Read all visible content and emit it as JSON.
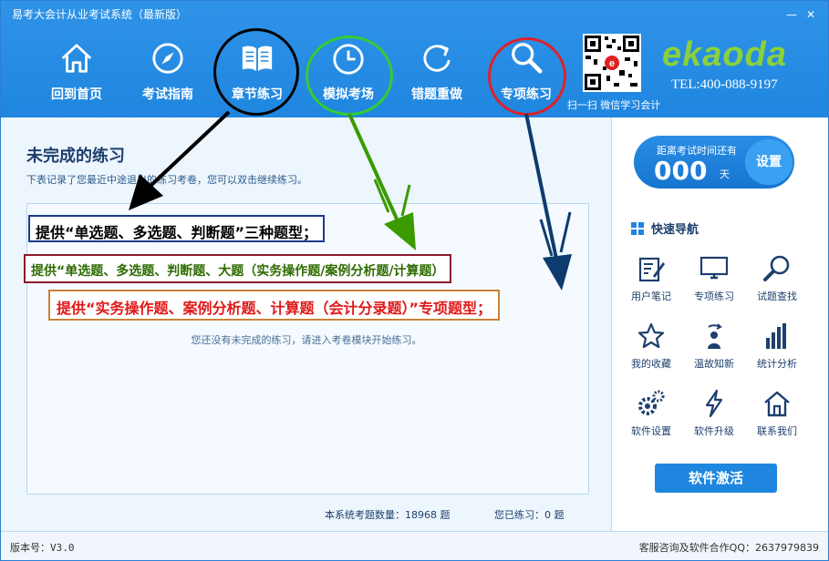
{
  "window": {
    "title": "易考大会计从业考试系统（最新版）",
    "minimize": "—",
    "close": "✕"
  },
  "toolbar": {
    "items": [
      {
        "label": "回到首页",
        "icon": "home-icon"
      },
      {
        "label": "考试指南",
        "icon": "compass-icon"
      },
      {
        "label": "章节练习",
        "icon": "book-icon"
      },
      {
        "label": "模拟考场",
        "icon": "clock-icon"
      },
      {
        "label": "错题重做",
        "icon": "refresh-icon"
      },
      {
        "label": "专项练习",
        "icon": "search-icon"
      }
    ],
    "qr_caption": "扫一扫 微信学习会计",
    "brand_logo": "ekaoda",
    "brand_phone": "TEL:400-088-9197"
  },
  "main": {
    "title": "未完成的练习",
    "description": "下表记录了您最近中途退出的练习考卷，您可以双击继续练习。",
    "empty_message": "您还没有未完成的练习，请进入考卷模块开始练习。",
    "total_questions": "本系统考题数量：18968 题",
    "practiced": "您已练习：0 题"
  },
  "annotations": {
    "note1": "提供“单选题、多选题、判断题”三种题型；",
    "note2": "提供“单选题、多选题、判断题、大题（实务操作题/案例分析题/计算题）",
    "note3": "提供“实务操作题、案例分析题、计算题（会计分录题）”专项题型；",
    "colors": {
      "ring_chapter": "#000000",
      "ring_exam": "#33cc33",
      "ring_special": "#e0202a",
      "arrow_black": "#000000",
      "arrow_green": "#3a9a00",
      "arrow_navy": "#0d3b6e"
    }
  },
  "sidebar": {
    "countdown_label": "距离考试时间还有",
    "countdown_value": "000",
    "countdown_unit": "天",
    "set_button": "设置",
    "nav_title": "快速导航",
    "nav_items": [
      {
        "label": "用户笔记",
        "icon": "note-icon"
      },
      {
        "label": "专项练习",
        "icon": "monitor-icon"
      },
      {
        "label": "试题查找",
        "icon": "search-icon"
      },
      {
        "label": "我的收藏",
        "icon": "star-icon"
      },
      {
        "label": "温故知新",
        "icon": "user-refresh-icon"
      },
      {
        "label": "统计分析",
        "icon": "bar-chart-icon"
      },
      {
        "label": "软件设置",
        "icon": "gear-icon"
      },
      {
        "label": "软件升级",
        "icon": "lightning-icon"
      },
      {
        "label": "联系我们",
        "icon": "house-icon"
      }
    ],
    "activate_button": "软件激活"
  },
  "status": {
    "version": "版本号：V3.0",
    "contact": "客服咨询及软件合作QQ：2637979839"
  }
}
